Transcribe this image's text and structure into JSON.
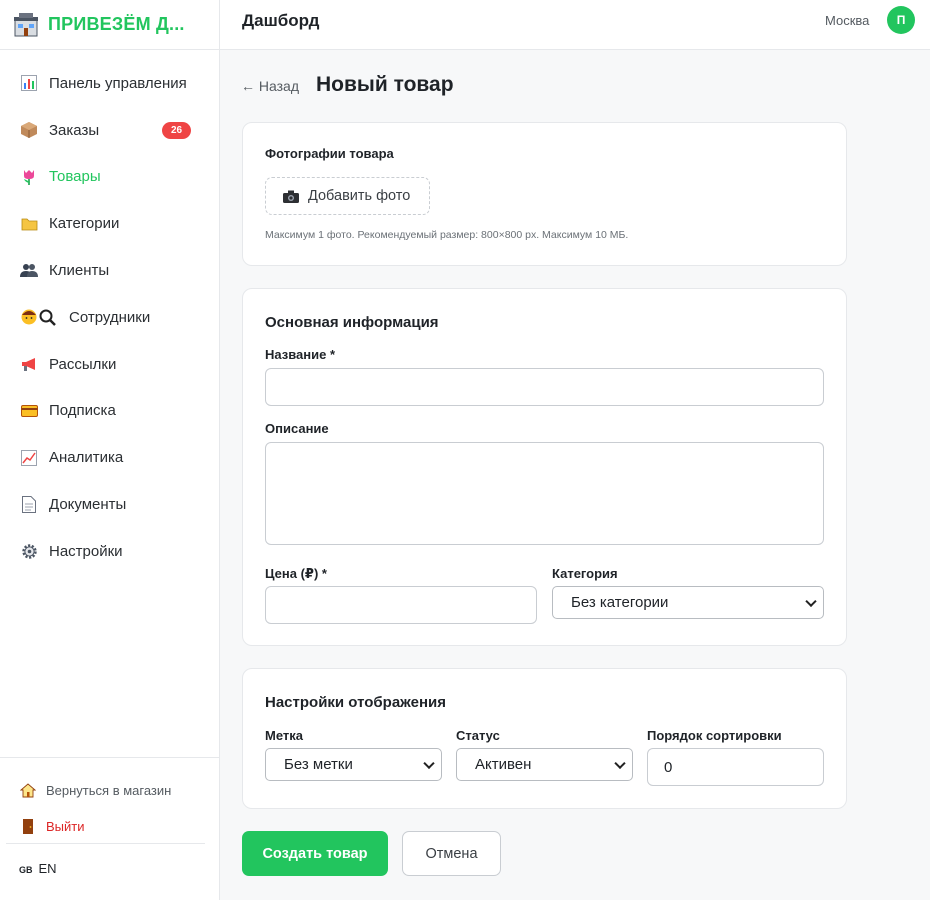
{
  "brand": {
    "name": "ПРИВЕЗЁМ Д...",
    "icon": "store-icon",
    "color": "#22c55e"
  },
  "sidebar": {
    "items": [
      {
        "label": "Панель управления",
        "icon": "bar-chart-icon"
      },
      {
        "label": "Заказы",
        "icon": "package-icon",
        "badge": "26"
      },
      {
        "label": "Товары",
        "icon": "tulip-icon",
        "active": true
      },
      {
        "label": "Категории",
        "icon": "folder-icon"
      },
      {
        "label": "Клиенты",
        "icon": "users-icon"
      },
      {
        "label": "Сотрудники",
        "icon": "staff-icon"
      },
      {
        "label": "Рассылки",
        "icon": "megaphone-icon"
      },
      {
        "label": "Подписка",
        "icon": "credit-card-icon"
      },
      {
        "label": "Аналитика",
        "icon": "line-chart-icon"
      },
      {
        "label": "Документы",
        "icon": "document-icon"
      },
      {
        "label": "Настройки",
        "icon": "gear-icon"
      }
    ],
    "back_to_store": "Вернуться в магазин",
    "logout": "Выйти",
    "lang_flag": "GB",
    "lang": "EN"
  },
  "topbar": {
    "title": "Дашборд",
    "city": "Москва",
    "avatar_letter": "П"
  },
  "page": {
    "back": "← Назад",
    "title": "Новый товар"
  },
  "photos": {
    "label": "Фотографии товара",
    "add_button": "Добавить фото",
    "hint": "Максимум 1 фото. Рекомендуемый размер: 800×800 px. Максимум 10 МБ."
  },
  "basic": {
    "title": "Основная информация",
    "name_label": "Название *",
    "name_value": "",
    "description_label": "Описание",
    "description_value": "",
    "price_label": "Цена (₽) *",
    "price_value": "",
    "category_label": "Категория",
    "category_value": "Без категории"
  },
  "display": {
    "title": "Настройки отображения",
    "tag_label": "Метка",
    "tag_value": "Без метки",
    "status_label": "Статус",
    "status_value": "Активен",
    "sort_label": "Порядок сортировки",
    "sort_value": "0"
  },
  "actions": {
    "create": "Создать товар",
    "cancel": "Отмена"
  },
  "colors": {
    "accent": "#22c55e",
    "danger": "#ef4444"
  }
}
